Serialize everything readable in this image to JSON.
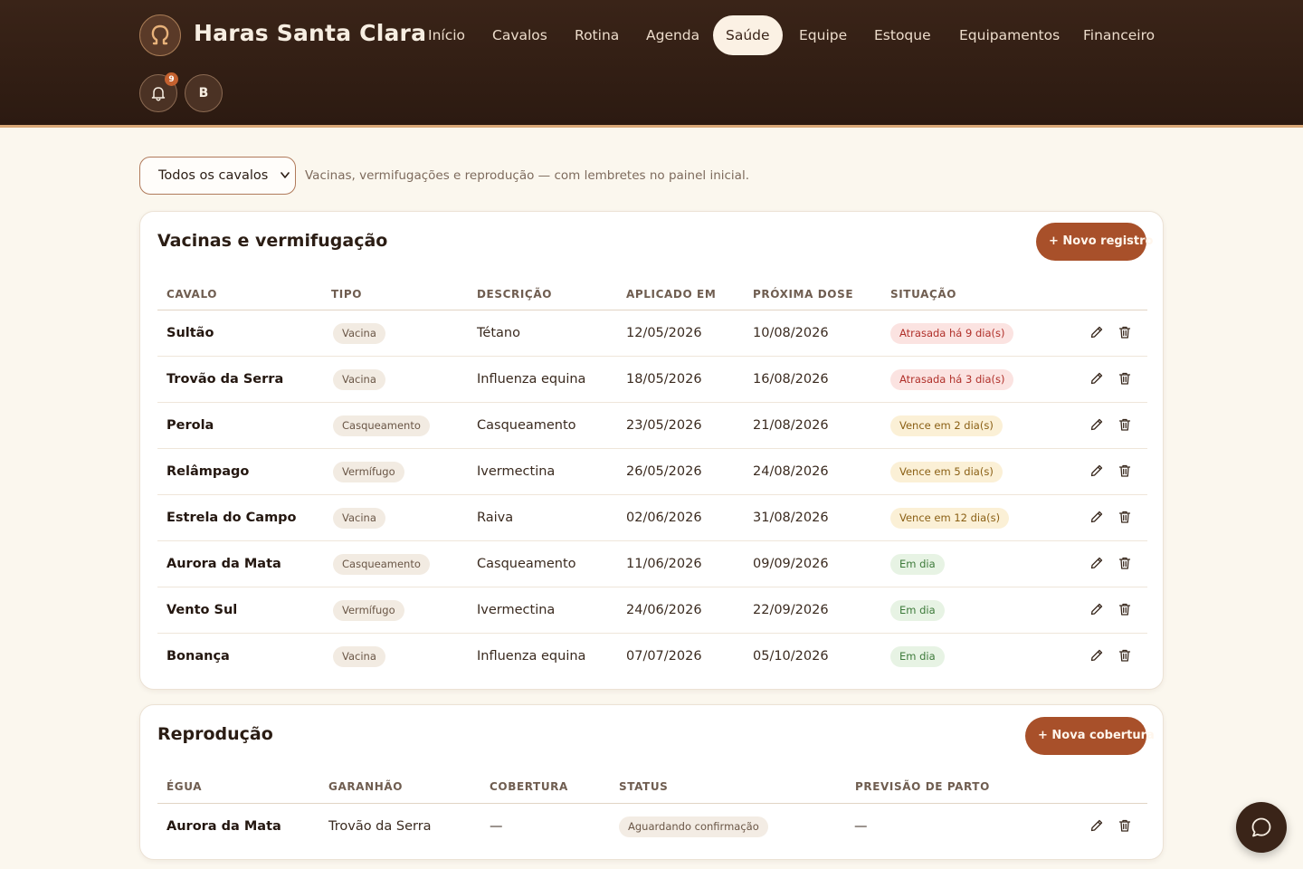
{
  "app": {
    "brand": "Haras Santa Clara",
    "logo_icon": "horseshoe-icon"
  },
  "nav": {
    "items": [
      {
        "label": "Início",
        "active": false
      },
      {
        "label": "Cavalos",
        "active": false
      },
      {
        "label": "Rotina",
        "active": false
      },
      {
        "label": "Agenda",
        "active": false
      },
      {
        "label": "Saúde",
        "active": true
      },
      {
        "label": "Equipe",
        "active": false
      },
      {
        "label": "Estoque",
        "active": false
      },
      {
        "label": "Equipamentos",
        "active": false
      },
      {
        "label": "Financeiro",
        "active": false
      }
    ]
  },
  "header_actions": {
    "notification_count": "9",
    "avatar_initial": "B"
  },
  "filter": {
    "selected": "Todos os cavalos",
    "hint": "Vacinas, vermifugações e reprodução — com lembretes no painel inicial."
  },
  "vaccines": {
    "title": "Vacinas e vermifugação",
    "new_button": "+ Novo registro",
    "columns": [
      "CAVALO",
      "TIPO",
      "DESCRIÇÃO",
      "APLICADO EM",
      "PRÓXIMA DOSE",
      "SITUAÇÃO"
    ],
    "rows": [
      {
        "horse": "Sultão",
        "type": "Vacina",
        "description": "Tétano",
        "applied": "12/05/2026",
        "next": "10/08/2026",
        "status": "Atrasada há 9 dia(s)",
        "status_kind": "late"
      },
      {
        "horse": "Trovão da Serra",
        "type": "Vacina",
        "description": "Influenza equina",
        "applied": "18/05/2026",
        "next": "16/08/2026",
        "status": "Atrasada há 3 dia(s)",
        "status_kind": "late"
      },
      {
        "horse": "Perola",
        "type": "Casqueamento",
        "description": "Casqueamento",
        "applied": "23/05/2026",
        "next": "21/08/2026",
        "status": "Vence em 2 dia(s)",
        "status_kind": "soon"
      },
      {
        "horse": "Relâmpago",
        "type": "Vermífugo",
        "description": "Ivermectina",
        "applied": "26/05/2026",
        "next": "24/08/2026",
        "status": "Vence em 5 dia(s)",
        "status_kind": "soon"
      },
      {
        "horse": "Estrela do Campo",
        "type": "Vacina",
        "description": "Raiva",
        "applied": "02/06/2026",
        "next": "31/08/2026",
        "status": "Vence em 12 dia(s)",
        "status_kind": "soon"
      },
      {
        "horse": "Aurora da Mata",
        "type": "Casqueamento",
        "description": "Casqueamento",
        "applied": "11/06/2026",
        "next": "09/09/2026",
        "status": "Em dia",
        "status_kind": "ok"
      },
      {
        "horse": "Vento Sul",
        "type": "Vermífugo",
        "description": "Ivermectina",
        "applied": "24/06/2026",
        "next": "22/09/2026",
        "status": "Em dia",
        "status_kind": "ok"
      },
      {
        "horse": "Bonança",
        "type": "Vacina",
        "description": "Influenza equina",
        "applied": "07/07/2026",
        "next": "05/10/2026",
        "status": "Em dia",
        "status_kind": "ok"
      }
    ]
  },
  "reproduction": {
    "title": "Reprodução",
    "new_button": "+ Nova cobertura",
    "columns": [
      "ÉGUA",
      "GARANHÃO",
      "COBERTURA",
      "STATUS",
      "PREVISÃO DE PARTO"
    ],
    "rows": [
      {
        "mare": "Aurora da Mata",
        "stallion": "Trovão da Serra",
        "covering": "—",
        "status": "Aguardando confirmação",
        "due": "—"
      }
    ]
  },
  "colors": {
    "header_bg": "#2c1a11",
    "accent": "#a8502a",
    "page_bg": "#fbf7ee",
    "late": "#b0302a",
    "soon": "#8a5f14",
    "ok": "#3d7a3a"
  }
}
